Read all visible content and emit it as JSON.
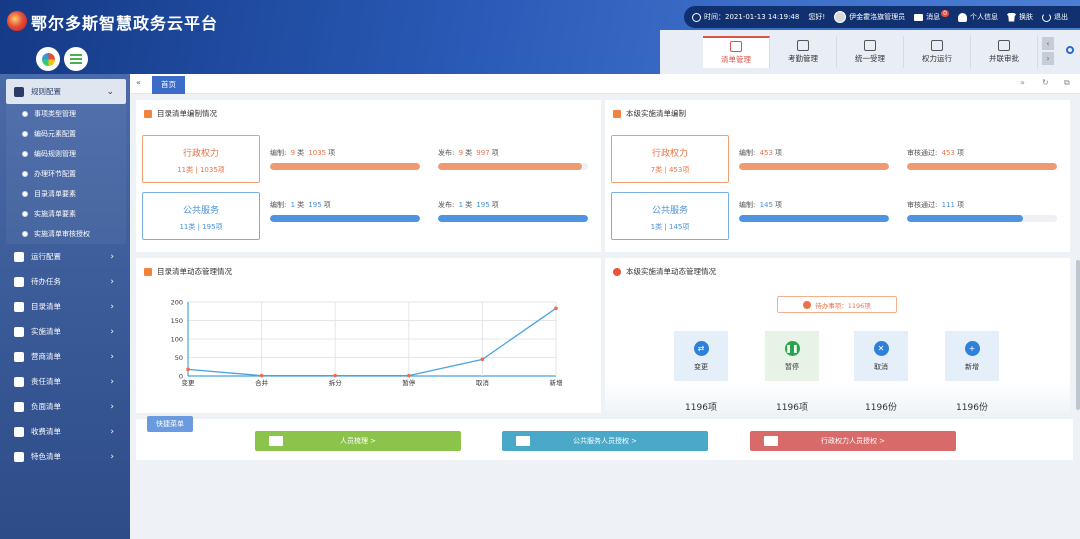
{
  "brand": {
    "title": "鄂尔多斯智慧政务云平台"
  },
  "topbar": {
    "time_label": "时间：",
    "time": "2021-01-13 14:19:48",
    "greeting": "您好!",
    "user": "伊金霍洛旗管理员",
    "messages": "消息",
    "messages_badge": "0",
    "profile": "个人信息",
    "skin": "换肤",
    "logout": "退出"
  },
  "topnav": {
    "tabs": [
      {
        "label": "清单管理",
        "icon": "list-card-icon"
      },
      {
        "label": "考勤管理",
        "icon": "move-arrows-icon"
      },
      {
        "label": "统一受理",
        "icon": "document-icon"
      },
      {
        "label": "权力运行",
        "icon": "calendar-check-icon"
      },
      {
        "label": "并联审批",
        "icon": "clipboard-icon"
      }
    ],
    "prev": "‹",
    "next": "›"
  },
  "sidebar": {
    "groups": [
      {
        "label": "规则配置",
        "icon": "wrench-icon",
        "chevron": "⌄",
        "items": [
          "事项类型管理",
          "编码元素配置",
          "编码规则管理",
          "办理环节配置",
          "目录清单要素",
          "实施清单要素",
          "实施清单审核授权"
        ]
      },
      {
        "label": "运行配置",
        "icon": "arrows-icon",
        "chevron": "›"
      },
      {
        "label": "待办任务",
        "icon": "checkbox-icon",
        "chevron": "›"
      },
      {
        "label": "目录清单",
        "icon": "list-icon",
        "chevron": "›"
      },
      {
        "label": "实施清单",
        "icon": "sitemap-icon",
        "chevron": "›"
      },
      {
        "label": "营商清单",
        "icon": "store-icon",
        "chevron": "›"
      },
      {
        "label": "责任清单",
        "icon": "anchor-icon",
        "chevron": "›"
      },
      {
        "label": "负面清单",
        "icon": "minus-circle-icon",
        "chevron": "›"
      },
      {
        "label": "收费清单",
        "icon": "cc-icon",
        "chevron": "›"
      },
      {
        "label": "特色清单",
        "icon": "folder-icon",
        "chevron": "›"
      }
    ]
  },
  "tabs": {
    "back": "«",
    "home": "首页",
    "forward": "»",
    "refresh": "↻",
    "fullscreen": "⧉"
  },
  "catalog_panel": {
    "title": "目录清单编制情况",
    "rows": [
      {
        "name": "行政权力",
        "sub_a": "11类",
        "sub_b": "1035项",
        "compile_label": "编制:",
        "compile_cat": "9",
        "compile_unit": "类",
        "compile_items": "1035",
        "compile_items_unit": "项",
        "compile_progress": 1.0,
        "publish_label": "发布:",
        "publish_cat": "9",
        "publish_unit": "类",
        "publish_items": "997",
        "publish_items_unit": "项",
        "publish_progress": 0.96
      },
      {
        "name": "公共服务",
        "sub_a": "11类",
        "sub_b": "195项",
        "compile_label": "编制:",
        "compile_cat": "1",
        "compile_unit": "类",
        "compile_items": "195",
        "compile_items_unit": "项",
        "compile_progress": 1.0,
        "publish_label": "发布:",
        "publish_cat": "1",
        "publish_unit": "类",
        "publish_items": "195",
        "publish_items_unit": "项",
        "publish_progress": 1.0
      }
    ]
  },
  "impl_panel": {
    "title": "本级实施清单编制",
    "rows": [
      {
        "name": "行政权力",
        "sub_a": "7类",
        "sub_b": "453项",
        "compile_label": "编制:",
        "compile_items": "453",
        "compile_items_unit": "项",
        "compile_progress": 1.0,
        "review_label": "审核通过:",
        "review_items": "453",
        "review_items_unit": "项",
        "review_progress": 1.0
      },
      {
        "name": "公共服务",
        "sub_a": "1类",
        "sub_b": "145项",
        "compile_label": "编制:",
        "compile_items": "145",
        "compile_items_unit": "项",
        "compile_progress": 1.0,
        "review_label": "审核通过:",
        "review_items": "111",
        "review_items_unit": "项",
        "review_progress": 0.77
      }
    ]
  },
  "dynamic_chart_panel": {
    "title": "目录清单动态管理情况"
  },
  "chart_data": {
    "type": "line",
    "title": "",
    "xlabel": "",
    "ylabel": "",
    "categories": [
      "变更",
      "合并",
      "拆分",
      "暂停",
      "取消",
      "新增"
    ],
    "series": [
      {
        "values": [
          18,
          1,
          1,
          1,
          45,
          183
        ]
      }
    ],
    "ylim": [
      0,
      200
    ],
    "yticks": [
      0,
      50,
      100,
      150,
      200
    ],
    "grid": true,
    "line_color": "#4aa3df",
    "marker_color": "#f06a4a"
  },
  "impl_dynamic_panel": {
    "title": "本级实施清单动态管理情况",
    "pending_label": "待办事项：",
    "pending_value": "1196项",
    "cards": [
      {
        "label": "变更",
        "icon": "shuffle-icon",
        "count": "1196项",
        "color": "#2f80d9"
      },
      {
        "label": "暂停",
        "icon": "pause-icon",
        "count": "1196项",
        "color": "#2aa44a"
      },
      {
        "label": "取消",
        "icon": "close-icon",
        "count": "1196份",
        "color": "#2f80d9"
      },
      {
        "label": "新增",
        "icon": "plus-icon",
        "count": "1196份",
        "color": "#2f80d9"
      }
    ]
  },
  "quick_menu": {
    "title": "快捷菜单",
    "buttons": [
      {
        "label": "人员梳理 >",
        "icon": "id-card-icon",
        "color": "#8cc34a"
      },
      {
        "label": "公共服务人员授权 >",
        "icon": "id-card-icon",
        "color": "#4aa8c8"
      },
      {
        "label": "行政权力人员授权 >",
        "icon": "id-card-icon",
        "color": "#d96a6a"
      }
    ]
  }
}
